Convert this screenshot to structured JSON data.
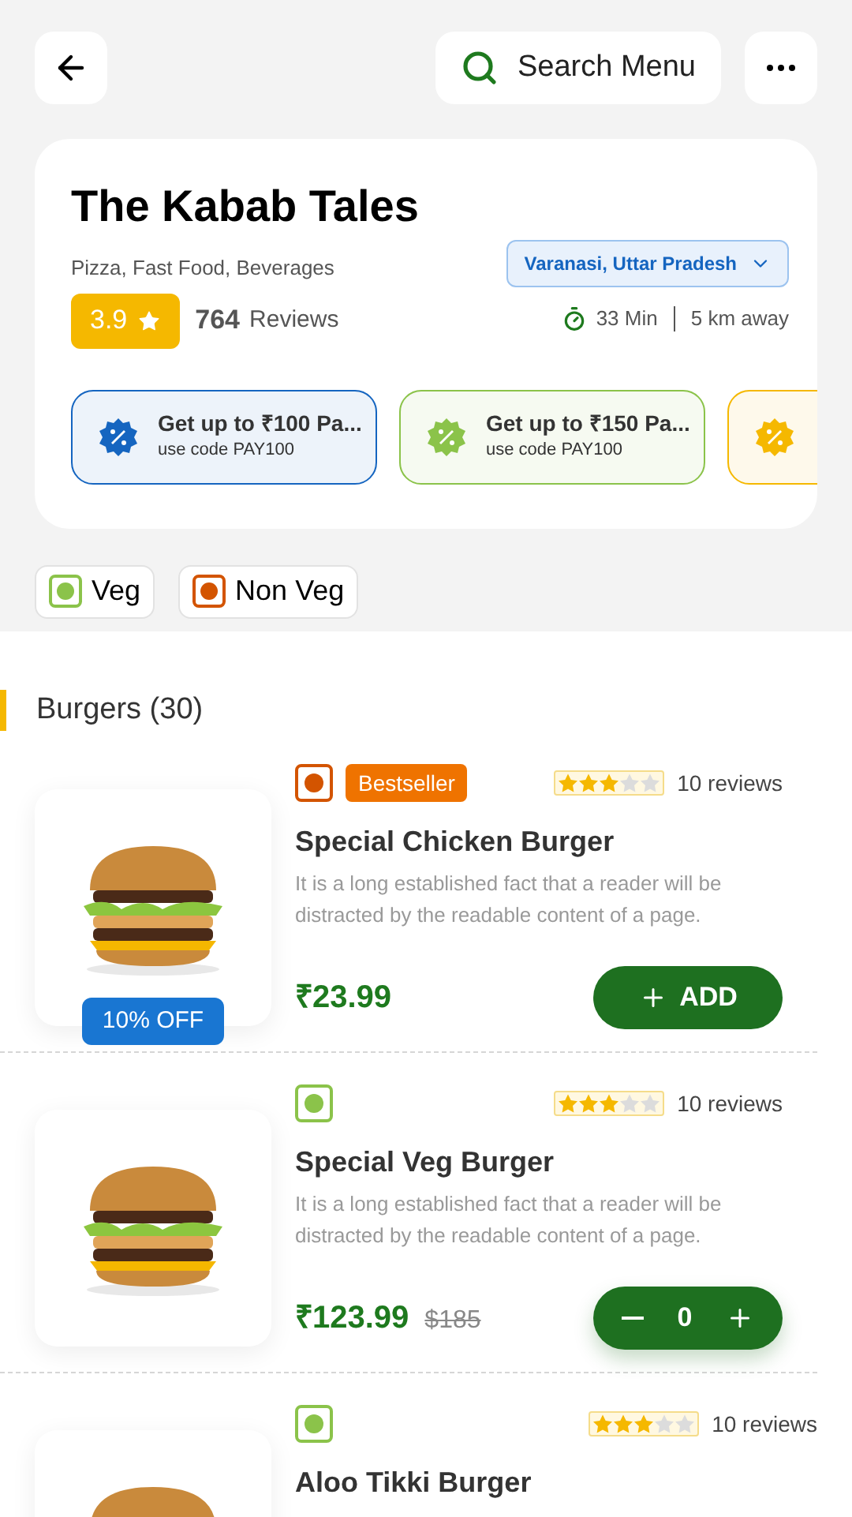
{
  "search": {
    "label": "Search Menu"
  },
  "restaurant": {
    "name": "The Kabab Tales",
    "cuisines": "Pizza, Fast Food, Beverages",
    "rating": "3.9",
    "reviews_count": "764",
    "reviews_label": "Reviews",
    "location": "Varanasi, Uttar Pradesh",
    "time": "33 Min",
    "distance": "5 km away"
  },
  "offers": [
    {
      "title": "Get up to ₹100 Pa...",
      "code": "use code PAY100",
      "color": "#1565c0"
    },
    {
      "title": "Get up to ₹150 Pa...",
      "code": "use code PAY100",
      "color": "#8bc34a"
    },
    {
      "color": "#f5b800"
    }
  ],
  "filters": [
    {
      "label": "Veg",
      "kind": "veg"
    },
    {
      "label": "Non Veg",
      "kind": "nonveg"
    }
  ],
  "section": {
    "title": "Burgers (30)"
  },
  "items": [
    {
      "kind": "nonveg",
      "badge": "Bestseller",
      "stars": 3,
      "reviews": "10 reviews",
      "name": "Special Chicken Burger",
      "description": "It is a long established fact that a reader will be distracted by the readable content of a page.",
      "price": "₹23.99",
      "discount": "10% OFF",
      "cart": {
        "kind": "add",
        "label": "ADD"
      }
    },
    {
      "kind": "veg",
      "stars": 3,
      "reviews": "10 reviews",
      "name": "Special Veg Burger",
      "description": "It is a long established fact that a reader will be distracted by the readable content of a page.",
      "price": "₹123.99",
      "old_price": "$185",
      "cart": {
        "kind": "stepper",
        "count": "0"
      }
    },
    {
      "kind": "veg",
      "stars": 3,
      "reviews": "10 reviews",
      "name": "Aloo Tikki Burger"
    }
  ]
}
